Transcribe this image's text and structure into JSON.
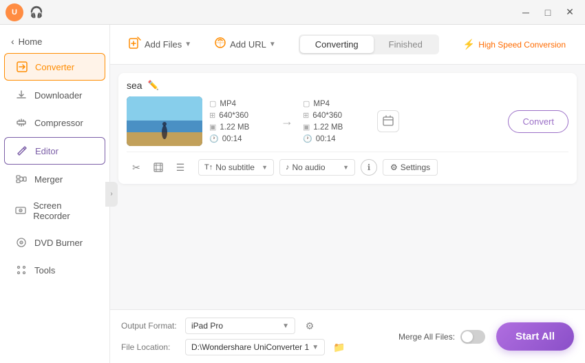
{
  "titlebar": {
    "avatar_text": "U",
    "min_label": "─",
    "max_label": "□",
    "close_label": "✕"
  },
  "sidebar": {
    "back_label": "Home",
    "items": [
      {
        "id": "converter",
        "label": "Converter",
        "active": true,
        "outline": false
      },
      {
        "id": "downloader",
        "label": "Downloader",
        "active": false
      },
      {
        "id": "compressor",
        "label": "Compressor",
        "active": false
      },
      {
        "id": "editor",
        "label": "Editor",
        "active": false,
        "outline": true
      },
      {
        "id": "merger",
        "label": "Merger",
        "active": false
      },
      {
        "id": "screen-recorder",
        "label": "Screen Recorder",
        "active": false
      },
      {
        "id": "dvd-burner",
        "label": "DVD Burner",
        "active": false
      },
      {
        "id": "tools",
        "label": "Tools",
        "active": false
      }
    ]
  },
  "toolbar": {
    "add_file_label": "Add Files",
    "add_url_label": "Add URL",
    "tab_converting": "Converting",
    "tab_finished": "Finished",
    "high_speed_label": "High Speed Conversion"
  },
  "file": {
    "name": "sea",
    "source": {
      "format": "MP4",
      "resolution": "640*360",
      "size": "1.22 MB",
      "duration": "00:14"
    },
    "target": {
      "format": "MP4",
      "resolution": "640*360",
      "size": "1.22 MB",
      "duration": "00:14"
    },
    "convert_btn": "Convert",
    "subtitle_label": "No subtitle",
    "audio_label": "No audio",
    "settings_label": "Settings"
  },
  "bottom": {
    "output_format_label": "Output Format:",
    "output_format_value": "iPad Pro",
    "file_location_label": "File Location:",
    "file_location_value": "D:\\Wondershare UniConverter 1",
    "merge_label": "Merge All Files:",
    "start_all_label": "Start All"
  }
}
